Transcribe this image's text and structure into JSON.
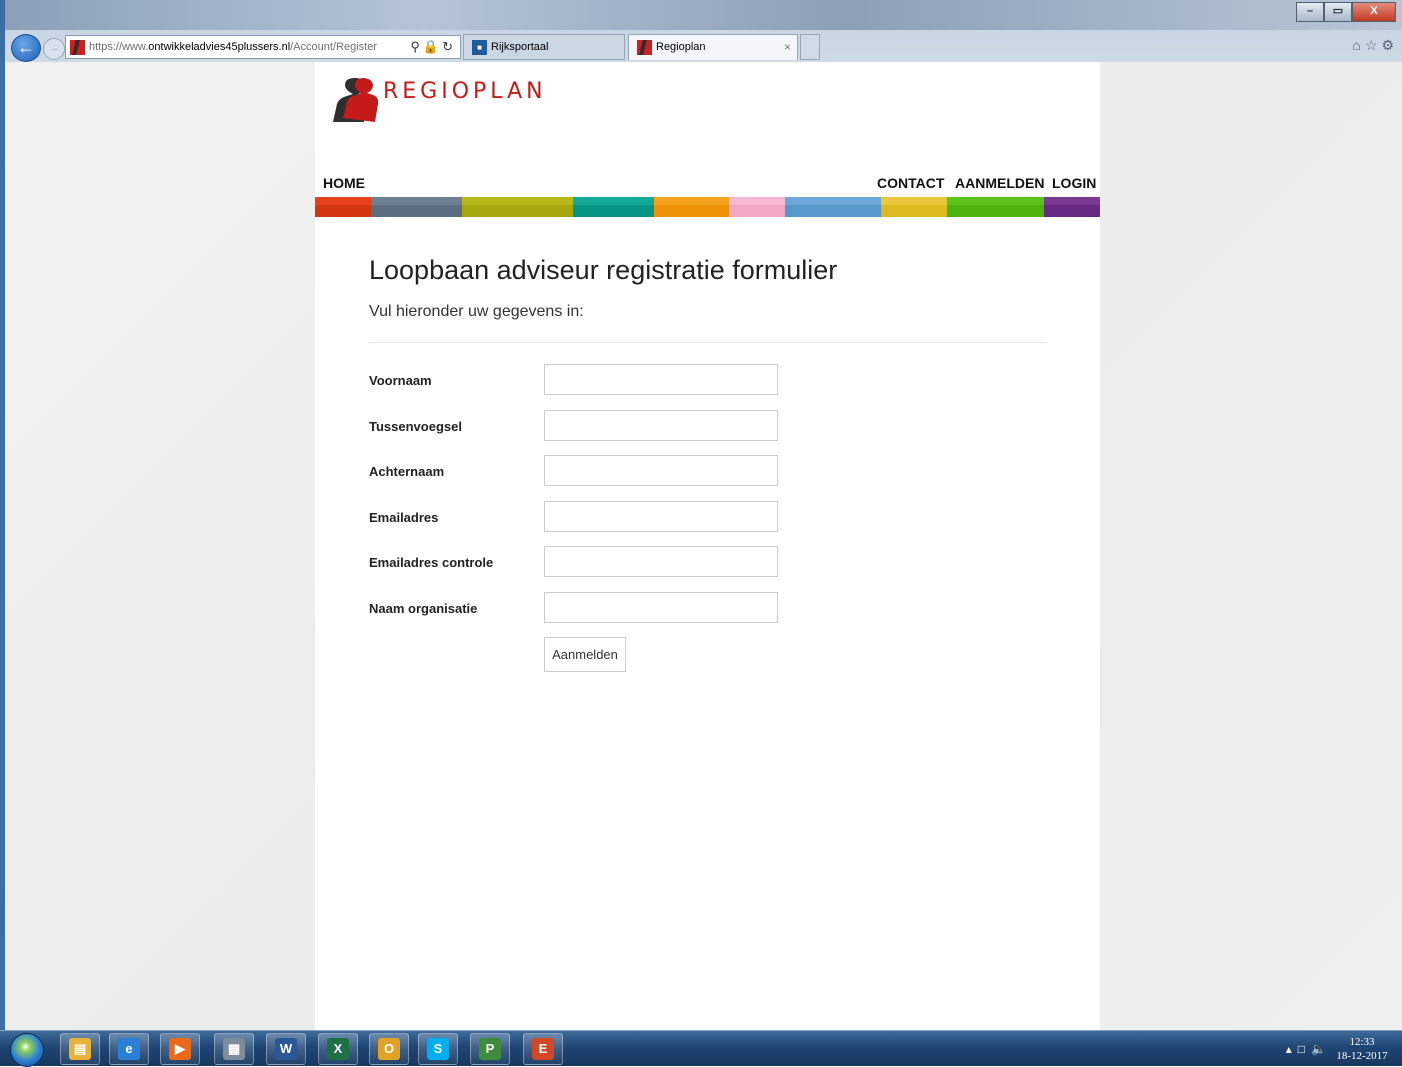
{
  "browser": {
    "address": {
      "scheme": "https://www.",
      "host": "ontwikkeladvies45plussers.nl",
      "path": "/Account/Register"
    },
    "tabs": [
      {
        "label": "Rijksportaal",
        "icon": "rijksportaal-favicon",
        "active": false
      },
      {
        "label": "Regioplan",
        "icon": "regioplan-favicon",
        "active": true
      }
    ],
    "tab_close_glyph": "×",
    "window_controls": {
      "minimize": "–",
      "maximize": "▭",
      "close": "X"
    }
  },
  "site": {
    "logo_text": "REGIOPLAN",
    "nav": {
      "home": "HOME",
      "contact": "CONTACT",
      "aanmelden": "AANMELDEN",
      "login": "LOGIN"
    },
    "color_bar": [
      {
        "light": "#e8401c",
        "dark": "#d2350f"
      },
      {
        "light": "#6d7f90",
        "dark": "#5b6e80"
      },
      {
        "light": "#b8b81a",
        "dark": "#a6a60f"
      },
      {
        "light": "#14a896",
        "dark": "#069484"
      },
      {
        "light": "#f5a31c",
        "dark": "#ee9308"
      },
      {
        "light": "#f7b8d2",
        "dark": "#f3a5c4"
      },
      {
        "light": "#6ea8d8",
        "dark": "#5697cc"
      },
      {
        "light": "#e8c83a",
        "dark": "#ddba1f"
      },
      {
        "light": "#5cc21c",
        "dark": "#4cb20c"
      },
      {
        "light": "#7a3a92",
        "dark": "#672883"
      }
    ]
  },
  "form": {
    "title": "Loopbaan adviseur registratie formulier",
    "subtitle": "Vul hieronder uw gegevens in:",
    "fields": [
      {
        "label": "Voornaam",
        "value": ""
      },
      {
        "label": "Tussenvoegsel",
        "value": ""
      },
      {
        "label": "Achternaam",
        "value": ""
      },
      {
        "label": "Emailadres",
        "value": ""
      },
      {
        "label": "Emailadres controle",
        "value": ""
      },
      {
        "label": "Naam organisatie",
        "value": ""
      }
    ],
    "submit_label": "Aanmelden"
  },
  "taskbar": {
    "apps": [
      {
        "name": "explorer-icon",
        "glyph": "▤",
        "color": "#e8b23a"
      },
      {
        "name": "internet-explorer-icon",
        "glyph": "e",
        "color": "#2a7fd6"
      },
      {
        "name": "media-player-icon",
        "glyph": "▶",
        "color": "#e86a1a"
      },
      {
        "name": "calculator-icon",
        "glyph": "▦",
        "color": "#7f8c99"
      },
      {
        "name": "word-icon",
        "glyph": "W",
        "color": "#2b5797"
      },
      {
        "name": "excel-icon",
        "glyph": "X",
        "color": "#1e7145"
      },
      {
        "name": "outlook-icon",
        "glyph": "O",
        "color": "#e0a325"
      },
      {
        "name": "skype-icon",
        "glyph": "S",
        "color": "#00aff0"
      },
      {
        "name": "project-icon",
        "glyph": "P",
        "color": "#3c8c3c"
      },
      {
        "name": "app-icon",
        "glyph": "E",
        "color": "#d24726"
      }
    ],
    "clock": {
      "time": "12:33",
      "date": "18-12-2017"
    }
  }
}
